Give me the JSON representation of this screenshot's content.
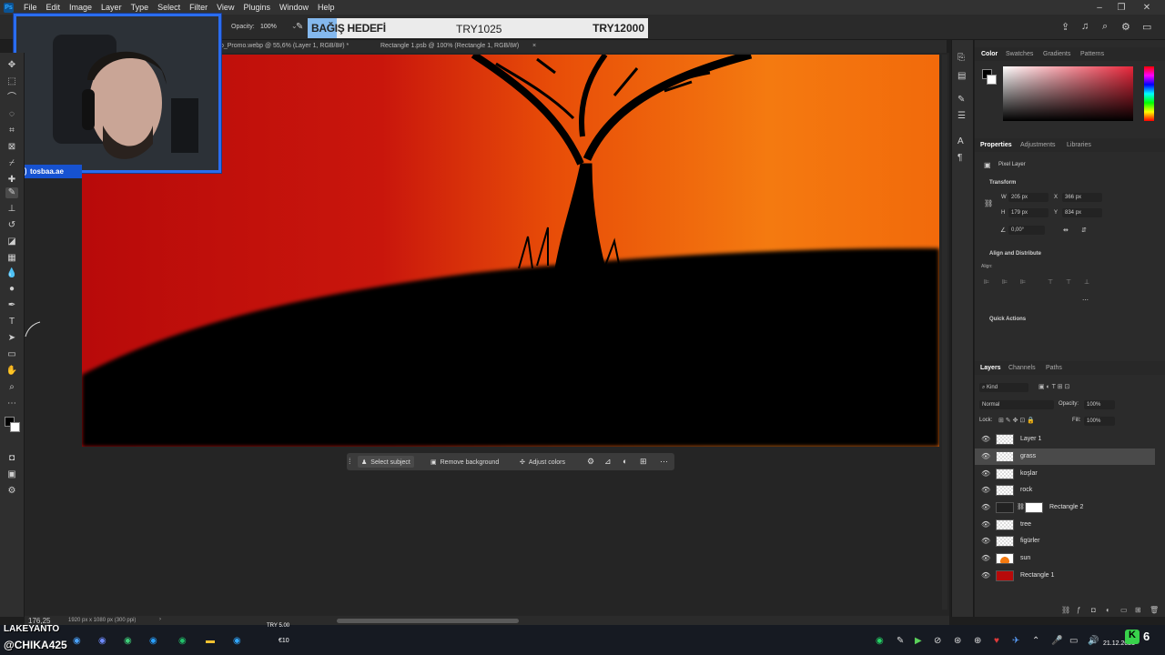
{
  "menu": [
    "File",
    "Edit",
    "Image",
    "Layer",
    "Type",
    "Select",
    "Filter",
    "View",
    "Plugins",
    "Window",
    "Help"
  ],
  "options": {
    "opacity_label": "Opacity:",
    "opacity_value": "100%"
  },
  "donation": {
    "label": "BAĞIŞ HEDEFİ",
    "current": "TRY1025",
    "goal": "TRY12000"
  },
  "tabs": [
    "to_Promo.webp @ 55,6% (Layer 1, RGB/8#) *",
    "Rectangle 1.psb @ 100% (Rectangle 1, RGB/8#)"
  ],
  "tab_close": "×",
  "webcam": {
    "tag": "tosbaa.ae"
  },
  "context_bar": {
    "select_subject": "Select subject",
    "remove_background": "Remove background",
    "adjust_colors": "Adjust colors"
  },
  "status": {
    "zoom": "176,25",
    "doc_size": "1920 px x 1080 px (300 ppi)"
  },
  "color_panel": {
    "tabs": [
      "Color",
      "Swatches",
      "Gradients",
      "Patterns"
    ]
  },
  "properties": {
    "tabs": [
      "Properties",
      "Adjustments",
      "Libraries"
    ],
    "kind": "Pixel Layer",
    "transform_title": "Transform",
    "w_label": "W",
    "w": "205 px",
    "h_label": "H",
    "h": "179 px",
    "x_label": "X",
    "x": "366 px",
    "y_label": "Y",
    "y": "834 px",
    "angle": "0,00°",
    "align_title": "Align and Distribute",
    "align_label": "Align:",
    "quick_actions": "Quick Actions"
  },
  "layers_panel": {
    "tabs": [
      "Layers",
      "Channels",
      "Paths"
    ],
    "kind_filter": "Kind",
    "blend_mode": "Normal",
    "opacity_label": "Opacity:",
    "opacity": "100%",
    "lock_label": "Lock:",
    "fill_label": "Fill:",
    "fill": "100%",
    "layers": [
      {
        "name": "Layer 1",
        "selected": false
      },
      {
        "name": "grass",
        "selected": true
      },
      {
        "name": "koşlar",
        "selected": false
      },
      {
        "name": "rock",
        "selected": false
      },
      {
        "name": "Rectangle 2",
        "selected": false
      },
      {
        "name": "tree",
        "selected": false
      },
      {
        "name": "figürler",
        "selected": false
      },
      {
        "name": "sun",
        "selected": false
      },
      {
        "name": "Rectangle 1",
        "selected": false
      }
    ]
  },
  "overlay": {
    "stream_name": "LAKEYANTO",
    "handle": "@CHIKA425",
    "tip": "TRY 5.00",
    "tip2": "€10"
  },
  "clock": {
    "date": "21.12.2023"
  },
  "colors": {
    "accent": "#2a6df0",
    "canvas_red": "#b80a0a",
    "canvas_orange": "#f47a10"
  }
}
